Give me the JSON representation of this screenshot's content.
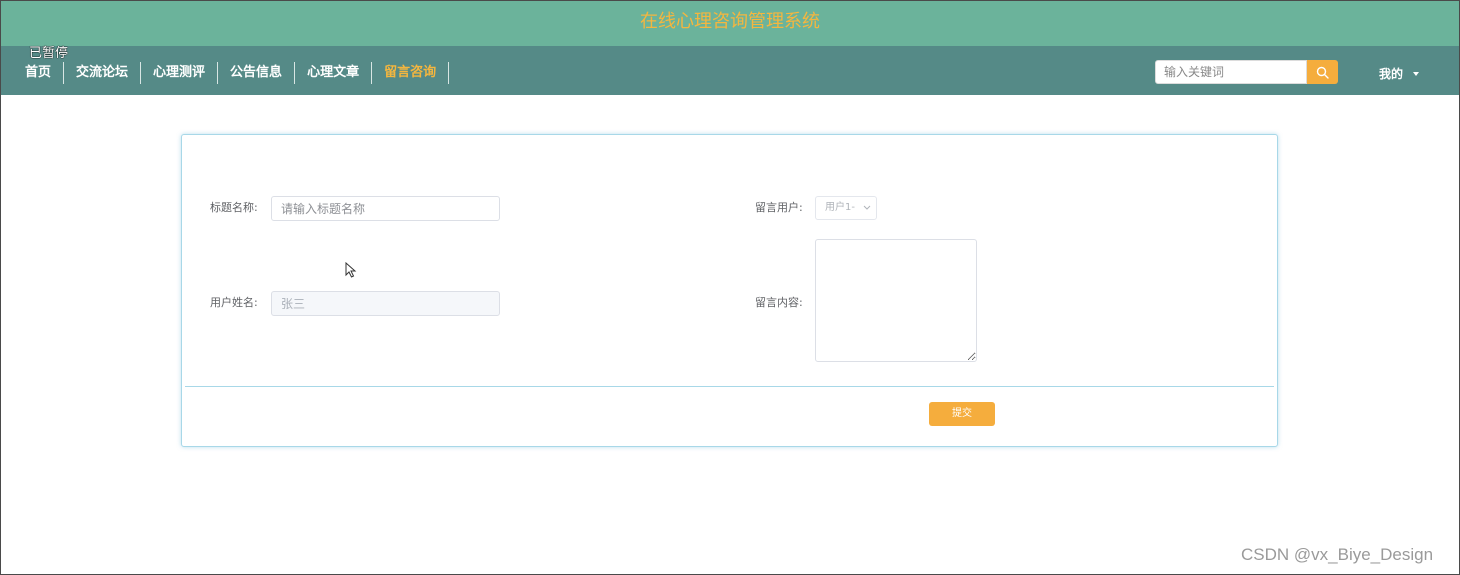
{
  "app": {
    "title": "在线心理咨询管理系统",
    "paused_label": "已暂停"
  },
  "nav": {
    "items": [
      {
        "label": "首页",
        "active": false
      },
      {
        "label": "交流论坛",
        "active": false
      },
      {
        "label": "心理测评",
        "active": false
      },
      {
        "label": "公告信息",
        "active": false
      },
      {
        "label": "心理文章",
        "active": false
      },
      {
        "label": "留言咨询",
        "active": true
      }
    ],
    "search_placeholder": "输入关键词",
    "search_icon": "search-icon",
    "user_menu_label": "我的"
  },
  "form": {
    "title_label": "标题名称:",
    "title_placeholder": "请输入标题名称",
    "user_label": "留言用户:",
    "user_select_value": "用户1-",
    "name_label": "用户姓名:",
    "name_value": "张三",
    "content_label": "留言内容:",
    "content_value": "",
    "submit_label": "提交"
  },
  "watermark": "CSDN @vx_Biye_Design",
  "colors": {
    "header_bg": "#6bb39b",
    "nav_bg": "#558a87",
    "accent": "#f5ad3d",
    "card_border": "#a8d8e8"
  }
}
